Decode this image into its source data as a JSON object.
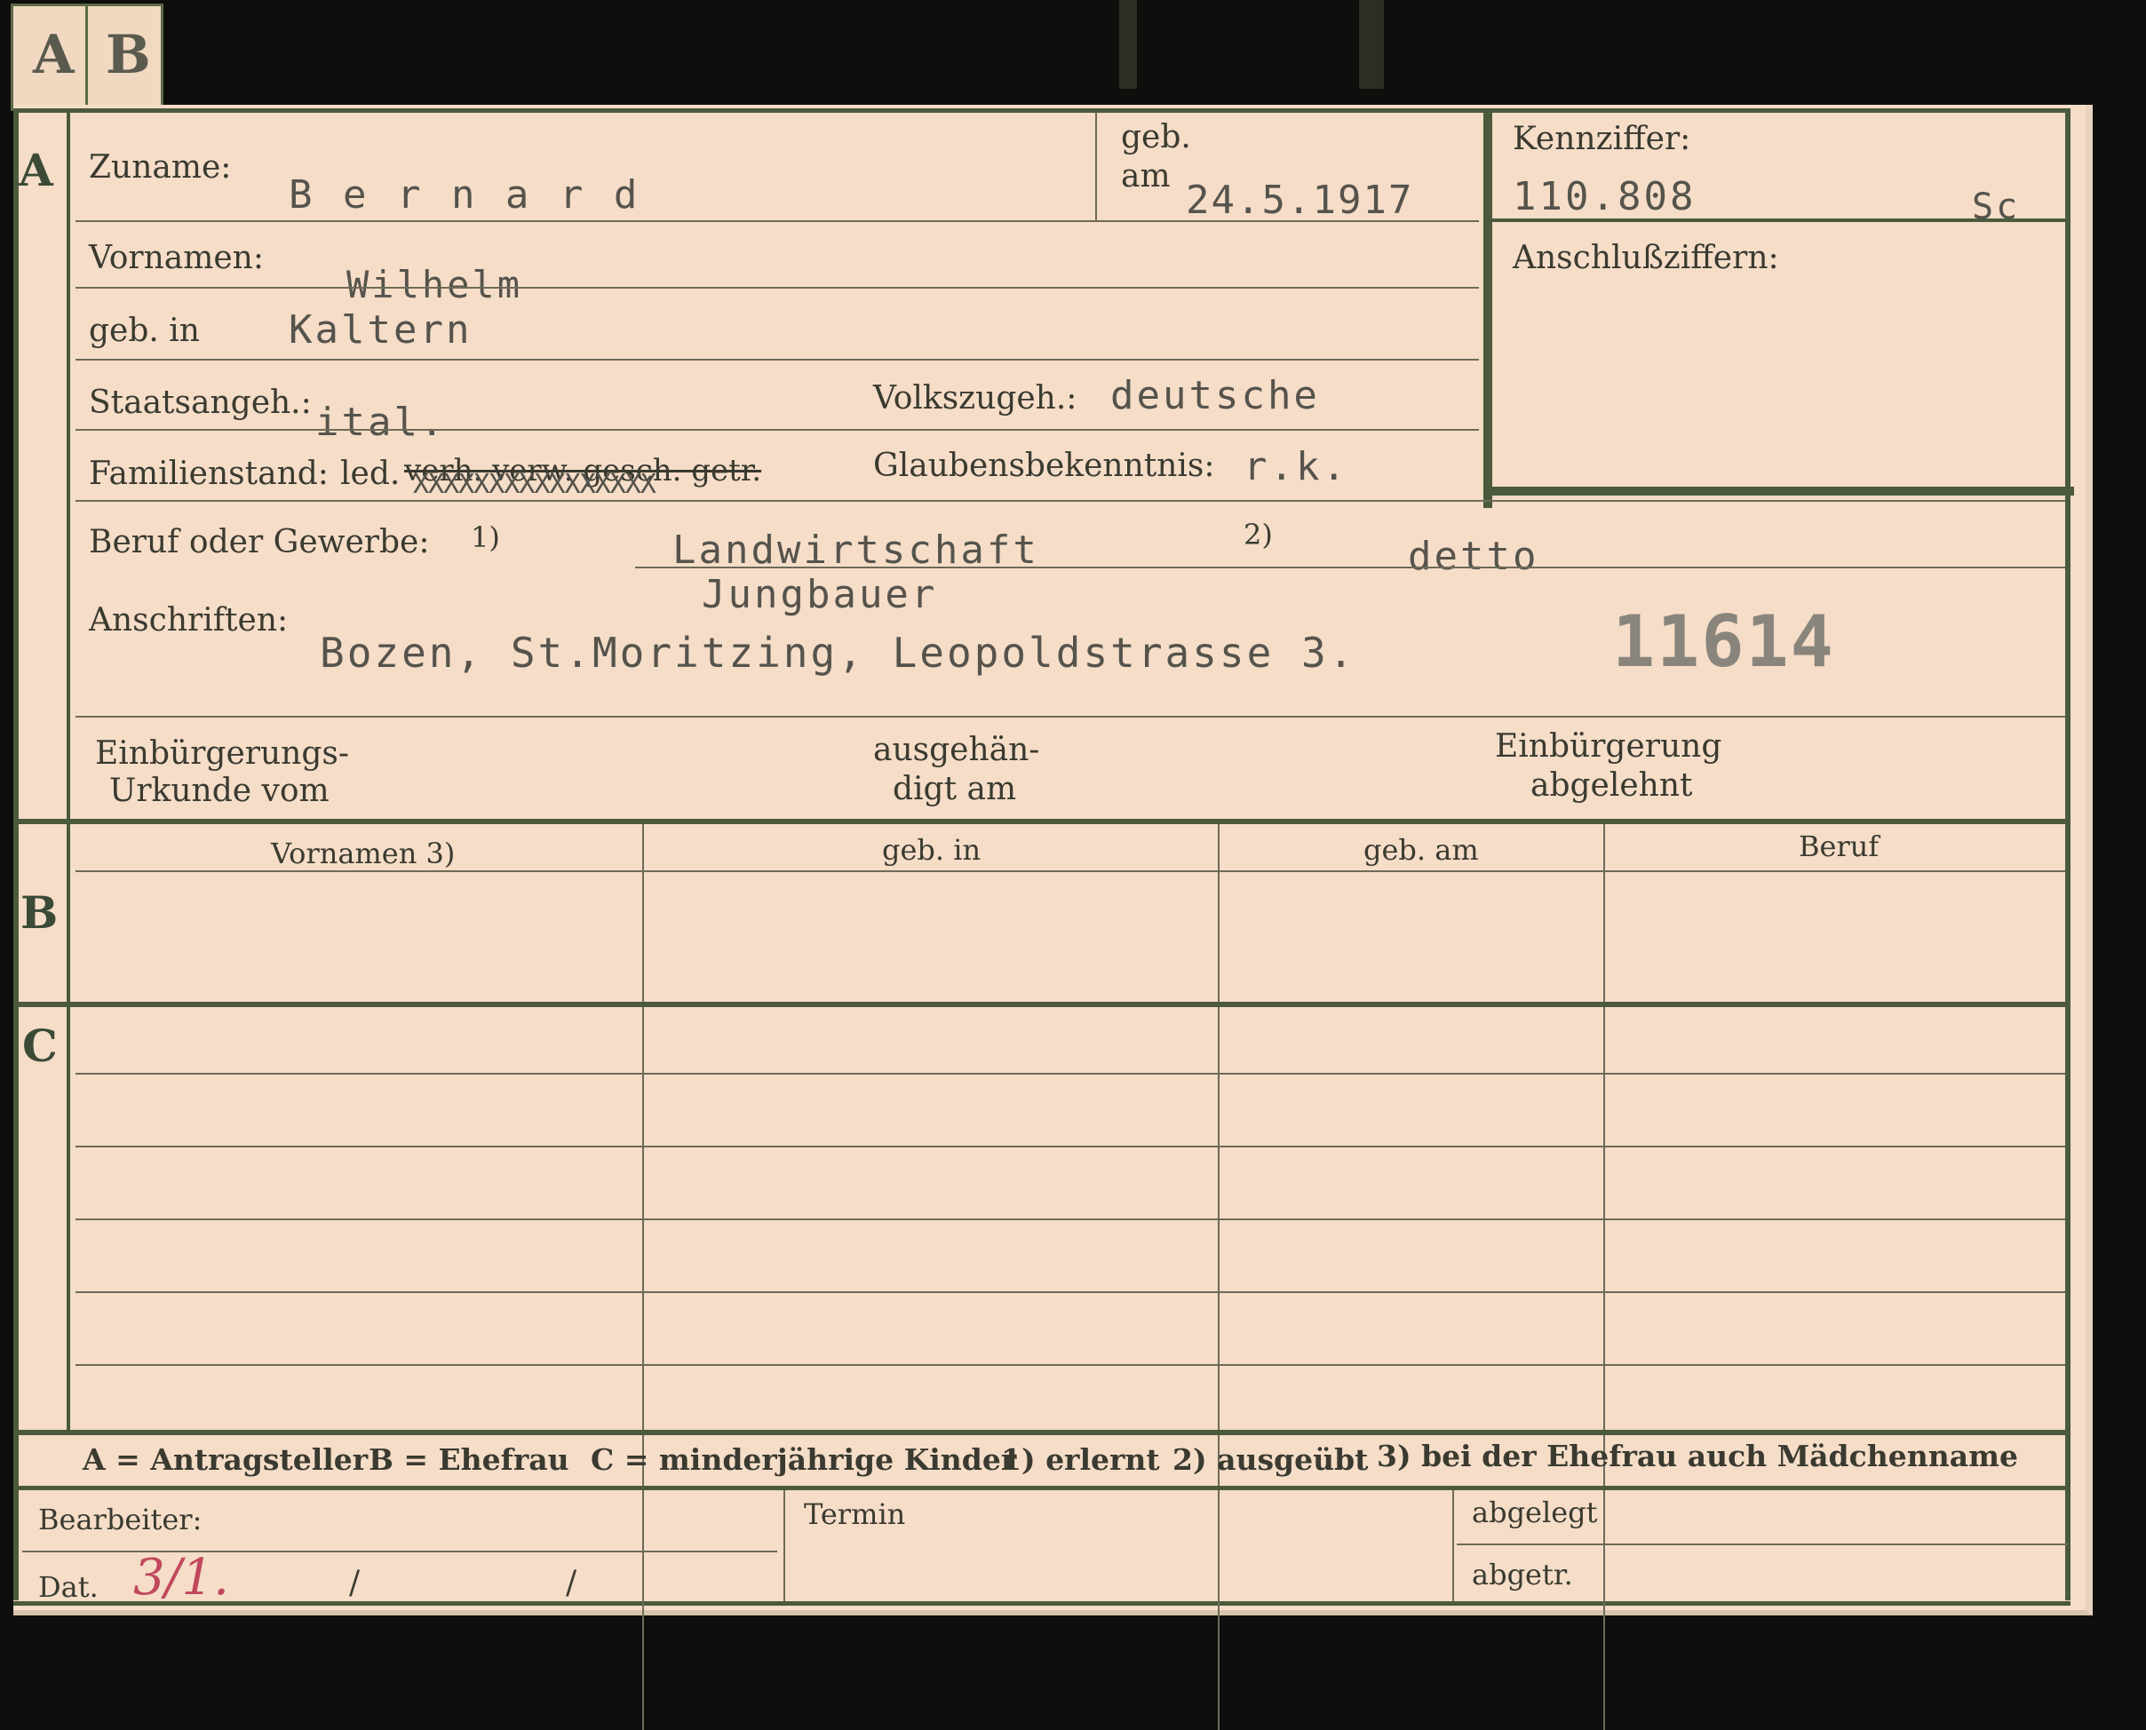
{
  "tabs": {
    "a": "A",
    "b": "B"
  },
  "section_a": {
    "letter": "A",
    "zuname_label": "Zuname:",
    "zuname_value": "B e r n a r d",
    "geb_label": "geb.",
    "am_label": "am",
    "birth_date": "24.5.1917",
    "vornamen_label": "Vornamen:",
    "vornamen_value": "Wilhelm",
    "geb_in_label": "geb. in",
    "geb_in_value": "Kaltern",
    "staatsangeh_label": "Staatsangeh.:",
    "staatsangeh_value": "ital.",
    "volkszugeh_label": "Volkszugeh.:",
    "volkszugeh_value": "deutsche",
    "familienstand_label": "Familienstand:",
    "familienstand_led": "led.",
    "familienstand_struck": "verh. verw. gesch. getr.",
    "familienstand_x": "XXXXXXXXXXXXXXXX",
    "glaubens_label": "Glaubensbekenntnis:",
    "glaubens_value": "r.k.",
    "beruf_label": "Beruf oder Gewerbe:",
    "beruf_fn1": "1)",
    "beruf_fn2": "2)",
    "beruf_value1": "Landwirtschaft",
    "beruf_value2": "detto",
    "beruf_value3": "Jungbauer",
    "anschriften_label": "Anschriften:",
    "anschrift_value": "Bozen, St.Moritzing, Leopoldstrasse 3.",
    "stamp_number": "11614",
    "einb_urkunde_label_1": "Einbürgerungs-",
    "einb_urkunde_label_2": "Urkunde vom",
    "ausgehaendigt_label_1": "ausgehän-",
    "ausgehaendigt_label_2": "digt am",
    "einb_abgelehnt_label_1": "Einbürgerung",
    "einb_abgelehnt_label_2": "abgelehnt"
  },
  "kennziffer": {
    "label": "Kennziffer:",
    "value": "110.808",
    "suffix": "Sc",
    "anschluss_label": "Anschlußziffern:"
  },
  "section_b": {
    "letter": "B",
    "headers": [
      "Vornamen 3)",
      "geb. in",
      "geb. am",
      "Beruf"
    ]
  },
  "section_c": {
    "letter": "C"
  },
  "legend": {
    "a": "A = Antragsteller",
    "b": "B = Ehefrau",
    "c": "C = minderjährige Kinder",
    "fn1": "1) erlernt",
    "fn2": "2) ausgeübt",
    "fn3": "3) bei der Ehefrau auch Mädchenname"
  },
  "footer": {
    "bearbeiter_label": "Bearbeiter:",
    "dat_label": "Dat.",
    "dat_value": "3/1.",
    "slash1": "/",
    "slash2": "/",
    "termin_label": "Termin",
    "abgelegt_label": "abgelegt",
    "abgetr_label": "abgetr."
  },
  "colors": {
    "card": "#f5ddc8",
    "border_green": "#4b5a3c",
    "ink": "#3a3a30",
    "typed": "#55534c",
    "red_pencil": "#c0485c",
    "background": "#0e0e0c"
  }
}
